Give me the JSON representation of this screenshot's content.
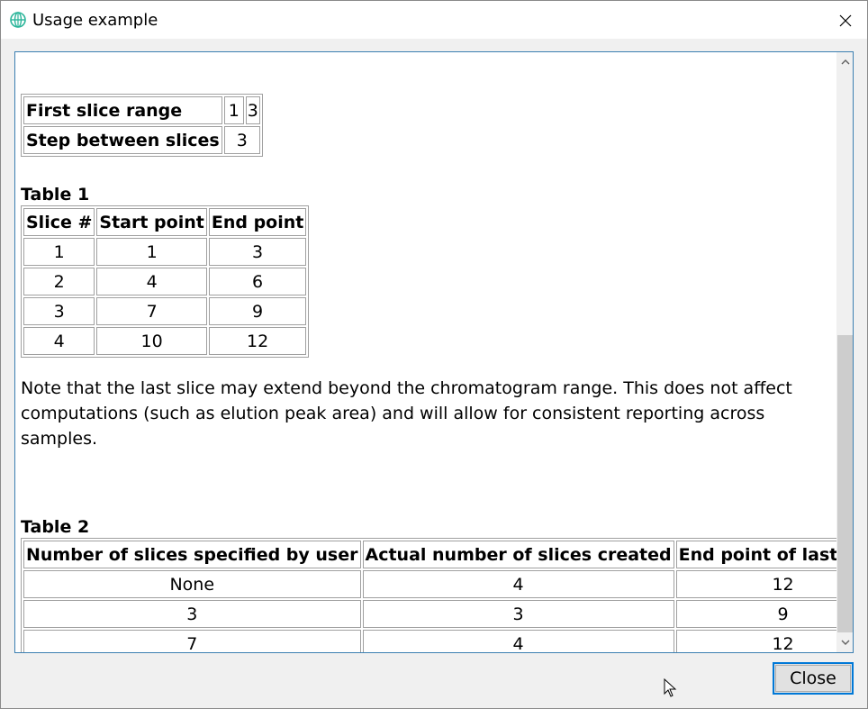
{
  "window": {
    "title": "Usage example"
  },
  "param_table": {
    "rows": [
      {
        "label": "First slice range",
        "values": [
          "1",
          "3"
        ]
      },
      {
        "label": "Step between slices",
        "values": [
          "3"
        ]
      }
    ]
  },
  "table1": {
    "caption": "Table 1",
    "headers": [
      "Slice #",
      "Start point",
      "End point"
    ],
    "rows": [
      [
        "1",
        "1",
        "3"
      ],
      [
        "2",
        "4",
        "6"
      ],
      [
        "3",
        "7",
        "9"
      ],
      [
        "4",
        "10",
        "12"
      ]
    ]
  },
  "note": "Note that the last slice may extend beyond the chromatogram range. This does not affect computations (such as elution peak area) and will allow for consistent reporting across samples.",
  "table2": {
    "caption": "Table 2",
    "headers": [
      "Number of slices specified by user",
      "Actual number of slices created",
      "End point of last slice"
    ],
    "rows": [
      [
        "None",
        "4",
        "12"
      ],
      [
        "3",
        "3",
        "9"
      ],
      [
        "7",
        "4",
        "12"
      ]
    ]
  },
  "buttons": {
    "close_label": "Close"
  },
  "icons": {
    "app": "app-logo-icon",
    "close": "close-icon",
    "scroll_up": "chevron-up-icon",
    "scroll_down": "chevron-down-icon",
    "cursor": "mouse-pointer-icon"
  },
  "colors": {
    "accent": "#0078d7",
    "frame_border": "#3c7fb1",
    "app_icon": "#2bb59a"
  }
}
